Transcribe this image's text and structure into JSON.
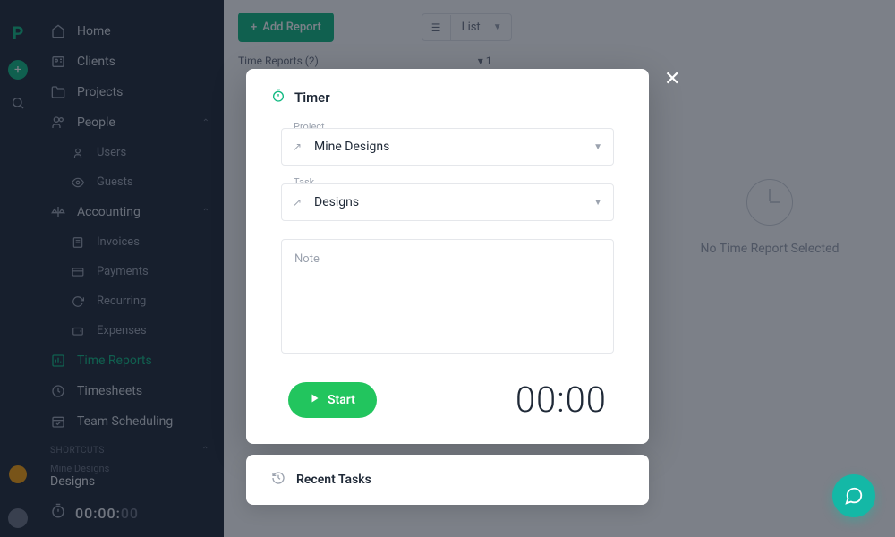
{
  "sidebar": {
    "items": [
      {
        "label": "Home",
        "icon": "home"
      },
      {
        "label": "Clients",
        "icon": "users"
      },
      {
        "label": "Projects",
        "icon": "folder"
      },
      {
        "label": "People",
        "icon": "people",
        "expand": true
      },
      {
        "label": "Users",
        "icon": "user",
        "sub": true
      },
      {
        "label": "Guests",
        "icon": "eye",
        "sub": true
      },
      {
        "label": "Accounting",
        "icon": "scale",
        "expand": true
      },
      {
        "label": "Invoices",
        "icon": "invoice",
        "sub": true
      },
      {
        "label": "Payments",
        "icon": "card",
        "sub": true
      },
      {
        "label": "Recurring",
        "icon": "loop",
        "sub": true
      },
      {
        "label": "Expenses",
        "icon": "wallet",
        "sub": true
      },
      {
        "label": "Time Reports",
        "icon": "chart",
        "active": true
      },
      {
        "label": "Timesheets",
        "icon": "clock"
      },
      {
        "label": "Team Scheduling",
        "icon": "calendar"
      }
    ],
    "shortcuts_header": "SHORTCUTS",
    "shortcut_project": "Mine Designs",
    "shortcut_task": "Designs",
    "timer_display": "00:00:",
    "timer_display_dim": "00"
  },
  "toolbar": {
    "add_report": "Add Report",
    "view_label": "List"
  },
  "listing": {
    "header": "Time Reports (2)",
    "filter_badge": "1"
  },
  "empty_state": "No Time Report Selected",
  "modal": {
    "title": "Timer",
    "project_label": "Project",
    "project_value": "Mine Designs",
    "task_label": "Task",
    "task_value": "Designs",
    "note_placeholder": "Note",
    "start_label": "Start",
    "time_display": "00:00",
    "time_bg": "00"
  },
  "recent_tasks": "Recent Tasks"
}
